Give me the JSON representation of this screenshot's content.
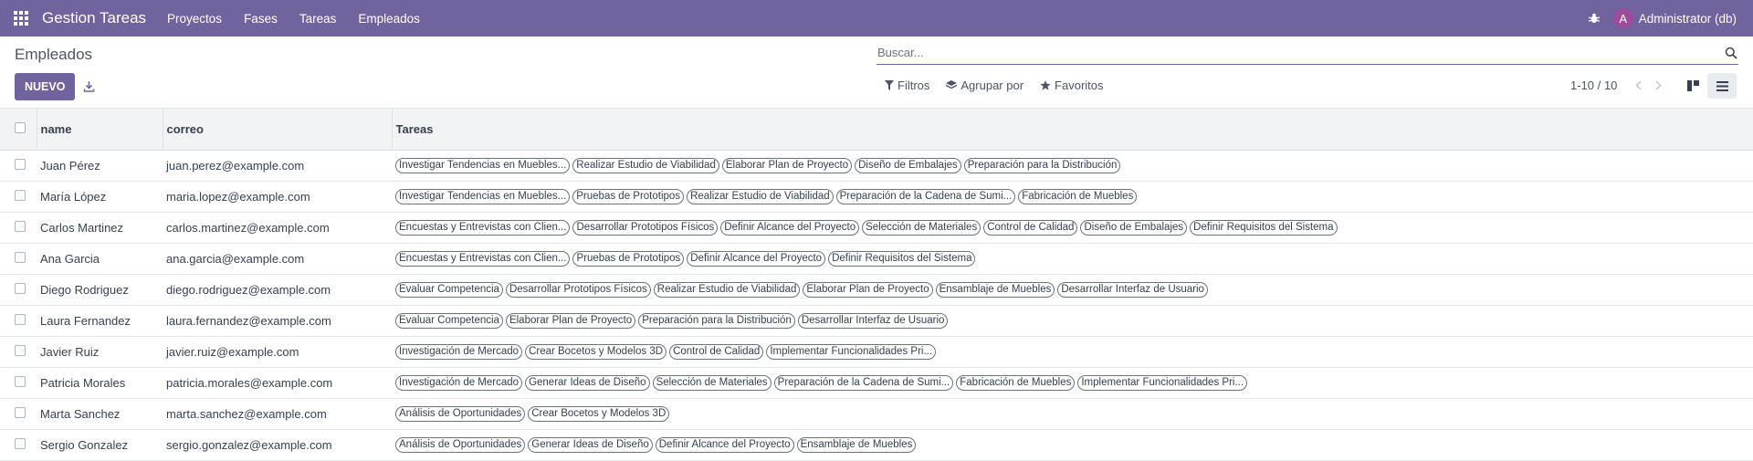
{
  "navbar": {
    "app_name": "Gestion Tareas",
    "menu": [
      "Proyectos",
      "Fases",
      "Tareas",
      "Empleados"
    ],
    "user_initial": "A",
    "user_name": "Administrator (db)",
    "color": "#71639e"
  },
  "control": {
    "title": "Empleados",
    "new_label": "NUEVO",
    "search_placeholder": "Buscar...",
    "filters_label": "Filtros",
    "group_label": "Agrupar por",
    "favorites_label": "Favoritos",
    "pager": "1-10 / 10"
  },
  "table": {
    "columns": [
      "name",
      "correo",
      "Tareas"
    ],
    "rows": [
      {
        "name": "Juan Pérez",
        "correo": "juan.perez@example.com",
        "tareas": [
          "Investigar Tendencias en Muebles...",
          "Realizar Estudio de Viabilidad",
          "Elaborar Plan de Proyecto",
          "Diseño de Embalajes",
          "Preparación para la Distribución"
        ]
      },
      {
        "name": "María López",
        "correo": "maria.lopez@example.com",
        "tareas": [
          "Investigar Tendencias en Muebles...",
          "Pruebas de Prototipos",
          "Realizar Estudio de Viabilidad",
          "Preparación de la Cadena de Sumi...",
          "Fabricación de Muebles"
        ]
      },
      {
        "name": "Carlos Martinez",
        "correo": "carlos.martinez@example.com",
        "tareas": [
          "Encuestas y Entrevistas con Clien...",
          "Desarrollar Prototipos Físicos",
          "Definir Alcance del Proyecto",
          "Selección de Materiales",
          "Control de Calidad",
          "Diseño de Embalajes",
          "Definir Requisitos del Sistema"
        ]
      },
      {
        "name": "Ana Garcia",
        "correo": "ana.garcia@example.com",
        "tareas": [
          "Encuestas y Entrevistas con Clien...",
          "Pruebas de Prototipos",
          "Definir Alcance del Proyecto",
          "Definir Requisitos del Sistema"
        ]
      },
      {
        "name": "Diego Rodriguez",
        "correo": "diego.rodriguez@example.com",
        "tareas": [
          "Evaluar Competencia",
          "Desarrollar Prototipos Físicos",
          "Realizar Estudio de Viabilidad",
          "Elaborar Plan de Proyecto",
          "Ensamblaje de Muebles",
          "Desarrollar Interfaz de Usuario"
        ]
      },
      {
        "name": "Laura Fernandez",
        "correo": "laura.fernandez@example.com",
        "tareas": [
          "Evaluar Competencia",
          "Elaborar Plan de Proyecto",
          "Preparación para la Distribución",
          "Desarrollar Interfaz de Usuario"
        ]
      },
      {
        "name": "Javier Ruiz",
        "correo": "javier.ruiz@example.com",
        "tareas": [
          "Investigación de Mercado",
          "Crear Bocetos y Modelos 3D",
          "Control de Calidad",
          "Implementar Funcionalidades Pri..."
        ]
      },
      {
        "name": "Patricia Morales",
        "correo": "patricia.morales@example.com",
        "tareas": [
          "Investigación de Mercado",
          "Generar Ideas de Diseño",
          "Selección de Materiales",
          "Preparación de la Cadena de Sumi...",
          "Fabricación de Muebles",
          "Implementar Funcionalidades Pri..."
        ]
      },
      {
        "name": "Marta Sanchez",
        "correo": "marta.sanchez@example.com",
        "tareas": [
          "Análisis de Oportunidades",
          "Crear Bocetos y Modelos 3D"
        ]
      },
      {
        "name": "Sergio Gonzalez",
        "correo": "sergio.gonzalez@example.com",
        "tareas": [
          "Análisis de Oportunidades",
          "Generar Ideas de Diseño",
          "Definir Alcance del Proyecto",
          "Ensamblaje de Muebles"
        ]
      }
    ]
  }
}
